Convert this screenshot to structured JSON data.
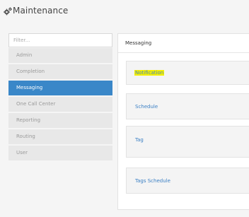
{
  "header": {
    "title": "Maintenance",
    "icon": "gears-icon"
  },
  "sidebar": {
    "filter_placeholder": "Filter...",
    "filter_value": "",
    "items": [
      {
        "label": "Admin",
        "active": false
      },
      {
        "label": "Completion",
        "active": false
      },
      {
        "label": "Messaging",
        "active": true
      },
      {
        "label": "One Call Center",
        "active": false
      },
      {
        "label": "Reporting",
        "active": false
      },
      {
        "label": "Routing",
        "active": false
      },
      {
        "label": "User",
        "active": false
      }
    ]
  },
  "main": {
    "title": "Messaging",
    "cards": [
      {
        "label": "Notification",
        "highlighted": true
      },
      {
        "label": "Schedule",
        "highlighted": false
      },
      {
        "label": "Tag",
        "highlighted": false
      },
      {
        "label": "Tags Schedule",
        "highlighted": false
      }
    ]
  },
  "colors": {
    "active": "#3a87c8",
    "link": "#3a7fc4",
    "highlight": "#f4f000"
  }
}
